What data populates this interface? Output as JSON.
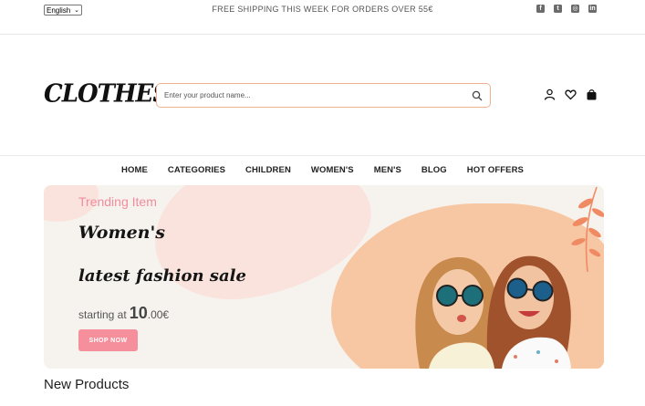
{
  "topbar": {
    "language": "English",
    "promo": "FREE SHIPPING THIS WEEK FOR ORDERS OVER 55€",
    "socials": [
      "facebook-icon",
      "twitter-icon",
      "instagram-icon",
      "linkedin-icon"
    ]
  },
  "header": {
    "logo": "CLOTHES",
    "search_placeholder": "Enter your product name..."
  },
  "nav": {
    "items": [
      "HOME",
      "CATEGORIES",
      "CHILDREN",
      "WOMEN'S",
      "MEN'S",
      "BLOG",
      "HOT OFFERS"
    ]
  },
  "hero": {
    "kicker": "Trending Item",
    "headline1": "Women's",
    "headline2": "latest fashion sale",
    "starting_prefix": "starting at",
    "price_whole": "10",
    "price_rest": ".00€",
    "cta": "SHOP NOW"
  },
  "sections": {
    "new_products": "New Products"
  },
  "colors": {
    "accent_pink": "#f58f9c",
    "peach": "#f7c7a3",
    "search_border": "#f0b28e"
  }
}
